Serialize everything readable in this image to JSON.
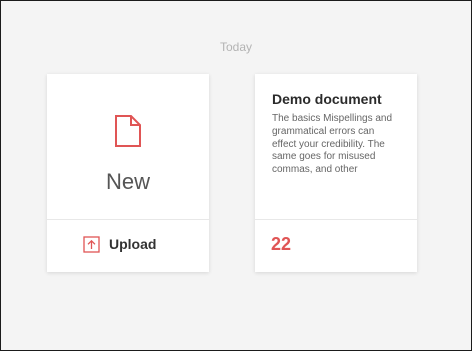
{
  "section": {
    "label": "Today"
  },
  "new_card": {
    "label": "New",
    "icon": "document-icon",
    "upload_label": "Upload",
    "upload_icon": "upload-icon"
  },
  "doc_card": {
    "title": "Demo document",
    "preview": "The basics Mispellings and grammatical errors can effect your credibility. The same goes for misused commas, and other",
    "score": "22"
  },
  "colors": {
    "accent": "#e05555",
    "background": "#f4f4f4",
    "card": "#ffffff"
  }
}
